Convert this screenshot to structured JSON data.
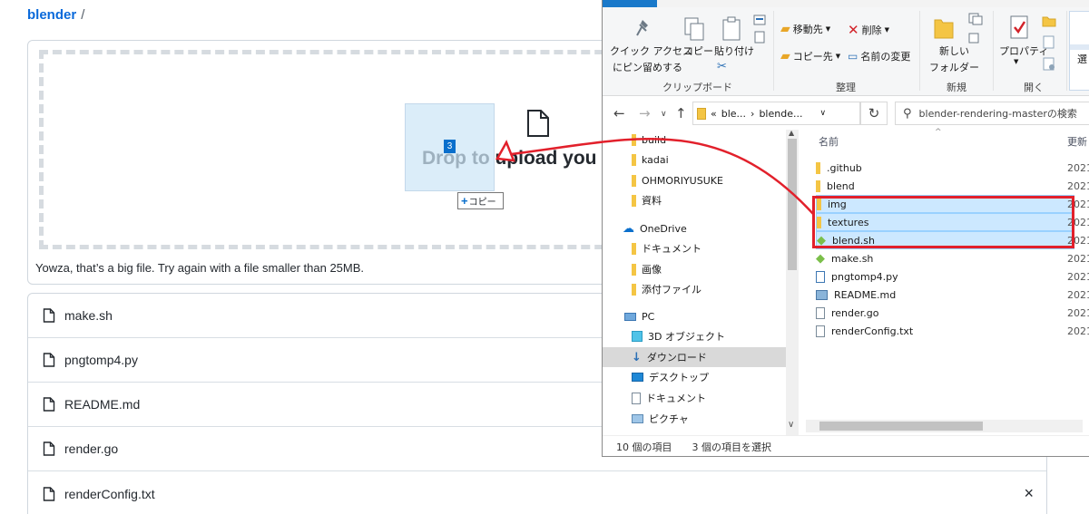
{
  "github": {
    "repo_name": "blender",
    "separator": "/",
    "drop_text": "Drop to upload you",
    "error_message": "Yowza, that’s a big file. Try again with a file smaller than 25MB.",
    "drag_count": "3",
    "copy_tooltip": "コピー",
    "files": [
      "make.sh",
      "pngtomp4.py",
      "README.md",
      "render.go",
      "renderConfig.txt"
    ],
    "close_label": "×"
  },
  "explorer": {
    "ribbon": {
      "pin_label_1": "クイック アクセス",
      "pin_label_2": "にピン留めする",
      "copy_label": "コピー",
      "paste_label": "貼り付け",
      "group_clipboard": "クリップボード",
      "move_to": "移動先",
      "copy_to": "コピー先",
      "delete": "削除",
      "rename": "名前の変更",
      "group_organize": "整理",
      "new_folder_1": "新しい",
      "new_folder_2": "フォルダー",
      "group_new": "新規",
      "properties": "プロパティ",
      "group_open": "開く",
      "select_label": "選"
    },
    "address": {
      "crumb_sep": "«",
      "crumb_1": "ble...",
      "crumb_2": "blende...",
      "search_placeholder": "blender-rendering-masterの検索"
    },
    "nav_items": {
      "build": "build",
      "kadai": "kadai",
      "ohmori": "OHMORIYUSUKE",
      "shiryo": "資料",
      "onedrive": "OneDrive",
      "documents_od": "ドキュメント",
      "images_od": "画像",
      "attachments_od": "添付ファイル",
      "pc": "PC",
      "objects3d": "3D オブジェクト",
      "downloads": "ダウンロード",
      "desktop": "デスクトップ",
      "documents_pc": "ドキュメント",
      "pictures_pc": "ピクチャ"
    },
    "column_name": "名前",
    "column_date": "更新",
    "date_prefix": "2021",
    "files": [
      {
        "name": ".github",
        "kind": "folder",
        "selected": false
      },
      {
        "name": "blend",
        "kind": "folder",
        "selected": false
      },
      {
        "name": "img",
        "kind": "folder",
        "selected": true
      },
      {
        "name": "textures",
        "kind": "folder",
        "selected": true
      },
      {
        "name": "blend.sh",
        "kind": "script",
        "selected": true
      },
      {
        "name": "make.sh",
        "kind": "script",
        "selected": false
      },
      {
        "name": "pngtomp4.py",
        "kind": "python",
        "selected": false
      },
      {
        "name": "README.md",
        "kind": "markdown",
        "selected": false
      },
      {
        "name": "render.go",
        "kind": "file",
        "selected": false
      },
      {
        "name": "renderConfig.txt",
        "kind": "text",
        "selected": false
      }
    ],
    "status": {
      "item_count": "10 個の項目",
      "selected_count": "3 個の項目を選択"
    }
  },
  "colors": {
    "link_blue": "#0969da",
    "highlight_red": "#e2202b",
    "selection_blue": "#cce8ff",
    "folder_yellow": "#f4c544"
  }
}
